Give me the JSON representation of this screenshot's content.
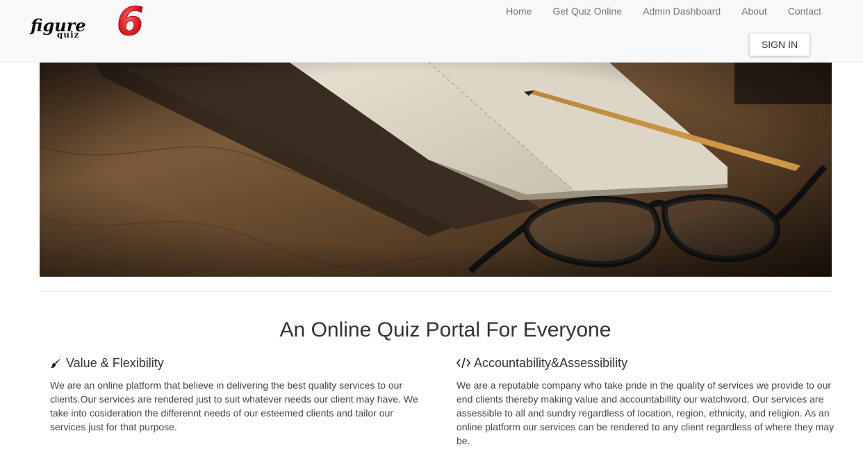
{
  "brand": {
    "logo_text": "figure",
    "logo_sub": "quiz",
    "logo_number": "6"
  },
  "nav": {
    "items": [
      {
        "label": "Home"
      },
      {
        "label": "Get Quiz Online"
      },
      {
        "label": "Admin Dashboard"
      },
      {
        "label": "About"
      },
      {
        "label": "Contact"
      }
    ],
    "signin_label": "SIGN IN"
  },
  "hero": {
    "image": "notebook-pencil-glasses"
  },
  "main": {
    "title": "An Online Quiz Portal For Everyone",
    "features": [
      {
        "icon": "paintbrush-icon",
        "heading": "Value & Flexibility",
        "body": "We are an online platform that believe in delivering the best quality services to our clients.Our services are rendered just to suit whatever needs our client may have. We take into cosideration the differennt needs of our esteemed clients and tailor our services just for that purpose."
      },
      {
        "icon": "code-icon",
        "heading": "Accountability&Assessibility",
        "body": "We are a reputable company who take pride in the quality of services we provide to our end clients thereby making value and accountabillity our watchword. Our services are assessible to all and sundry regardless of location, region, ethnicity, and religion. As an online platform our services can be rendered to any client regardless of where they may be."
      }
    ]
  },
  "colors": {
    "navbar_bg": "#f8f8f8",
    "logo_red": "#d9141b",
    "text": "#333333"
  }
}
